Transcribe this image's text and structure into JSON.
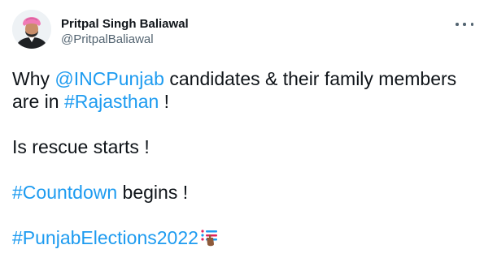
{
  "author": {
    "display_name": "Pritpal Singh Baliawal",
    "handle": "@PritpalBaliawal",
    "avatar_icon": "profile-avatar-icon"
  },
  "more_icon": "ellipsis-icon",
  "tweet": {
    "line1": {
      "t1": "Why ",
      "mention": "@INCPunjab",
      "t2": " candidates & their family members"
    },
    "line2": {
      "t1": "are in ",
      "hashtag": "#Rajasthan",
      "t2": " !"
    },
    "line3": {
      "t1": "Is rescue starts !"
    },
    "line4": {
      "hashtag": "#Countdown",
      "t2": " begins !"
    },
    "line5": {
      "hashtag": "#PunjabElections2022",
      "emoji": "ballot-voting-hashflag-icon"
    }
  },
  "colors": {
    "link": "#1d9bf0",
    "text": "#0f1419",
    "secondary": "#536471",
    "turban": "#f07bb6"
  }
}
